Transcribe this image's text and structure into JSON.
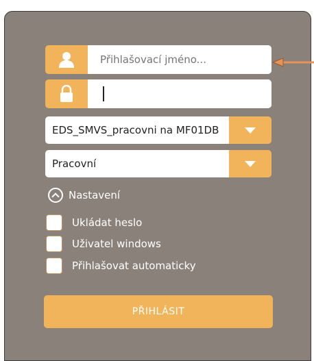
{
  "login": {
    "username_placeholder": "Přihlašovací jméno...",
    "password_value": "",
    "database_selected": "EDS_SMVS_pracovni na MF01DB",
    "mode_selected": "Pracovní",
    "settings_label": "Nastavení",
    "options": [
      {
        "label": "Ukládat heslo",
        "checked": false
      },
      {
        "label": "Uživatel windows",
        "checked": false
      },
      {
        "label": "Přihlašovat automaticky",
        "checked": false
      }
    ],
    "submit_label": "PŘIHLÁSIT"
  },
  "colors": {
    "panel_bg": "#8a827a",
    "accent": "#f2b45a",
    "annotation_arrow": "#e8935a"
  },
  "icons": {
    "username": "user-icon",
    "password": "lock-icon",
    "dropdown": "triangle-down-icon",
    "settings_toggle": "chevron-up-circle-icon"
  }
}
